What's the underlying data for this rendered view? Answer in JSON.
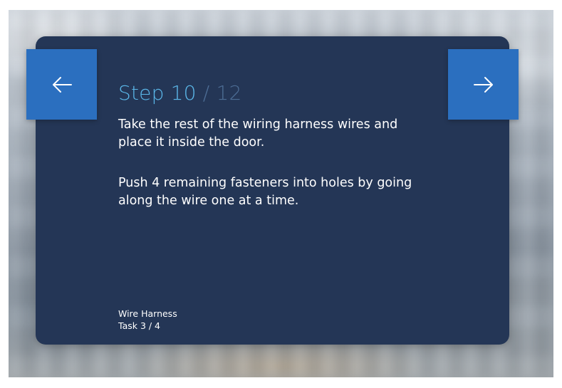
{
  "step": {
    "label": "Step 10",
    "separator": "/",
    "total": "12"
  },
  "instructions": [
    "Take the rest of the wiring harness wires and place it inside the door.",
    "Push 4 remaining fasteners into holes by going along the wire one at a time."
  ],
  "footer": {
    "procedure": "Wire Harness",
    "task": "Task 3 / 4"
  },
  "nav": {
    "prev_icon": "arrow-left-icon",
    "next_icon": "arrow-right-icon"
  },
  "colors": {
    "card_background": "#243656",
    "button_background": "#2b6fbf",
    "step_accent": "#5bb8ea",
    "step_muted": "#4d6d95",
    "text": "#ffffff"
  }
}
